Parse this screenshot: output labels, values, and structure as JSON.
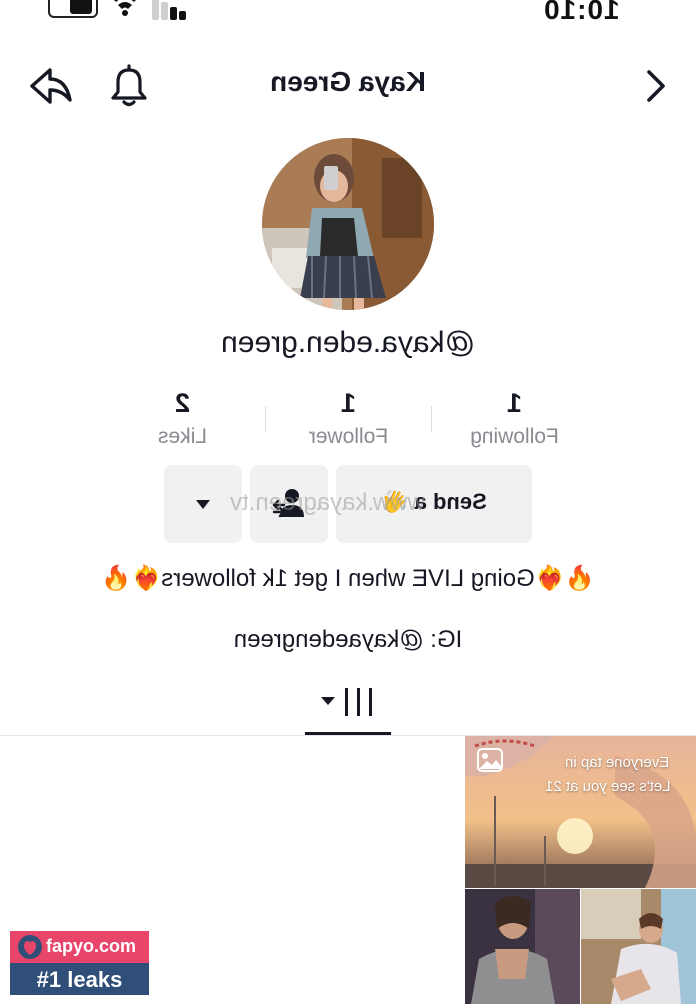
{
  "status_bar": {
    "time": "10:10"
  },
  "header": {
    "title": "Kaya Green",
    "icons": {
      "back": "share-arrow-icon",
      "notify": "bell-icon",
      "next": "chevron-right-icon"
    }
  },
  "profile": {
    "username": "@kaya.eden.green",
    "stats": [
      {
        "value": "1",
        "label": "Following"
      },
      {
        "value": "1",
        "label": "Follower"
      },
      {
        "value": "2",
        "label": "Likes"
      }
    ],
    "actions": {
      "send_label": "Send a 👋",
      "follow_icon": "add-friend-icon",
      "more_icon": "triangle-down-icon",
      "ghost_url": "www.kayagreen.tv"
    },
    "bio_line1": "🔥❤️‍🔥Going LIVE when I get 1k followers❤️‍🔥🔥",
    "bio_line2": "IG: @kayaedengreen"
  },
  "tabs": {
    "active": "videos-grid-icon"
  },
  "videos": [
    {
      "caption1": "Everyone tap in",
      "caption2": "Let's see you at 21",
      "badge": "photo-icon"
    },
    {
      "caption1": "",
      "caption2": ""
    },
    {
      "caption1": "",
      "caption2": ""
    }
  ],
  "watermark": {
    "site": "fapyo.com",
    "tag": "#1 leaks"
  },
  "colors": {
    "text": "#161823",
    "muted": "#8a8b91",
    "button_bg": "#f1f1f2",
    "watermark_pink": "#e8456b",
    "watermark_blue": "#2f4f78"
  }
}
